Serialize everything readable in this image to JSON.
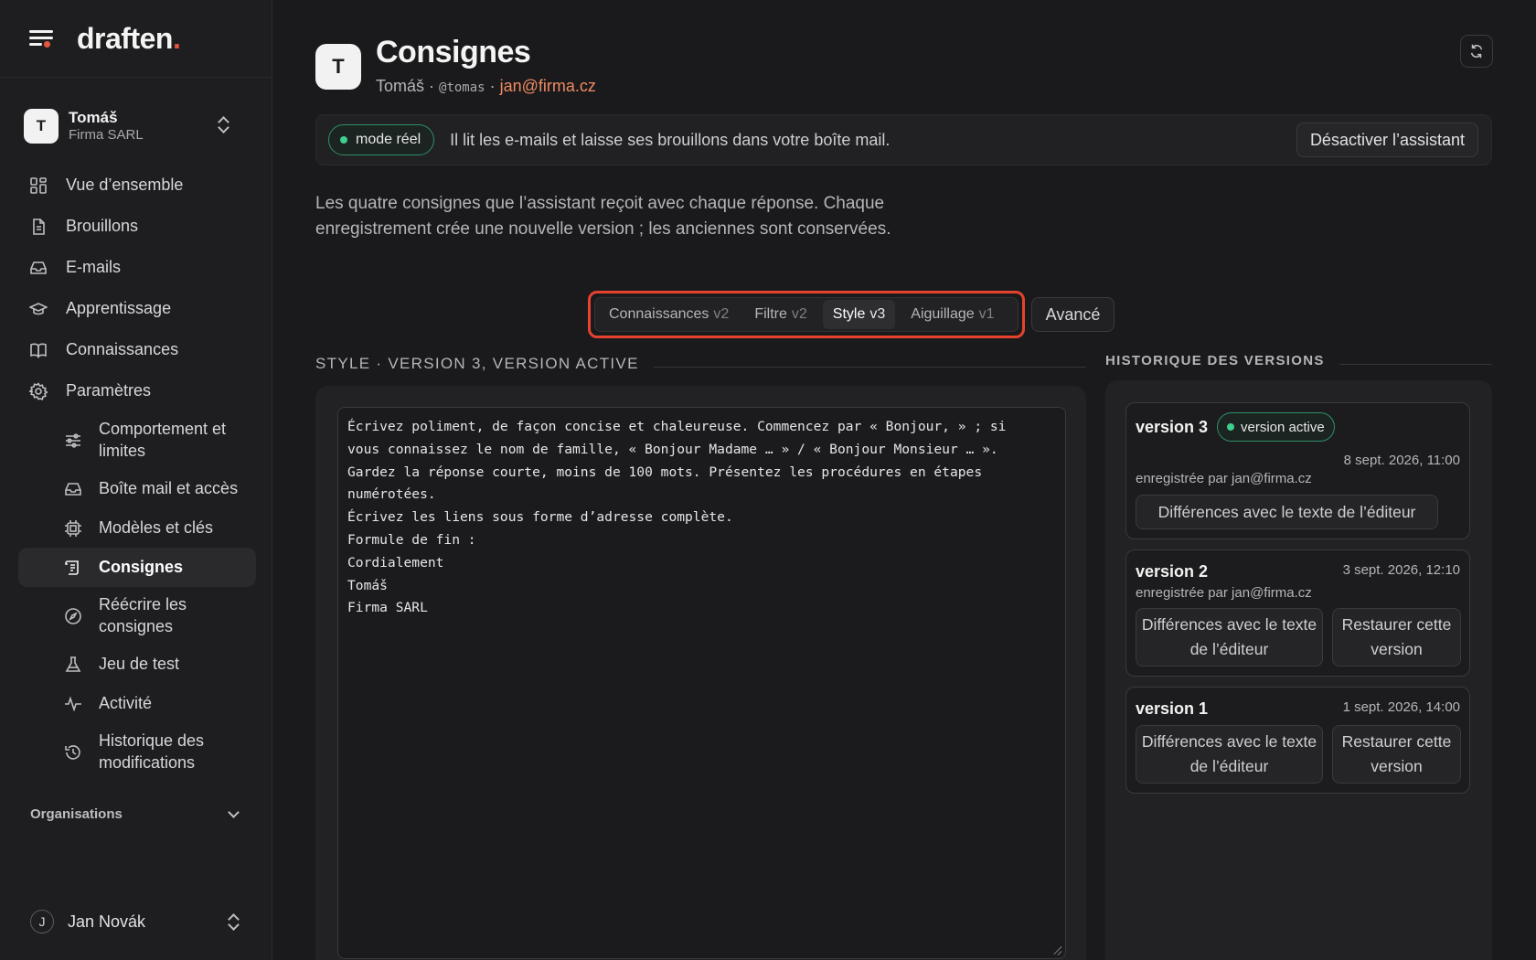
{
  "brand": {
    "name": "draften",
    "dot": "."
  },
  "account": {
    "initial": "T",
    "name": "Tomáš",
    "org": "Firma SARL"
  },
  "nav": {
    "items": [
      {
        "label": "Vue d’ensemble",
        "icon": "grid-icon"
      },
      {
        "label": "Brouillons",
        "icon": "document-icon"
      },
      {
        "label": "E-mails",
        "icon": "inbox-icon"
      },
      {
        "label": "Apprentissage",
        "icon": "graduation-cap-icon"
      },
      {
        "label": "Connaissances",
        "icon": "book-icon"
      },
      {
        "label": "Paramètres",
        "icon": "gear-icon"
      }
    ],
    "sub_items": [
      {
        "label": "Comportement et limites",
        "icon": "sliders-icon"
      },
      {
        "label": "Boîte mail et accès",
        "icon": "inbox-icon"
      },
      {
        "label": "Modèles et clés",
        "icon": "chip-icon"
      },
      {
        "label": "Consignes",
        "icon": "scroll-icon",
        "active": true
      },
      {
        "label": "Réécrire les consignes",
        "icon": "compass-icon"
      },
      {
        "label": "Jeu de test",
        "icon": "flask-icon"
      },
      {
        "label": "Activité",
        "icon": "activity-icon"
      },
      {
        "label": "Historique des modifications",
        "icon": "history-icon"
      }
    ]
  },
  "organisations_label": "Organisations",
  "user": {
    "initial": "J",
    "name": "Jan Novák"
  },
  "page": {
    "initial": "T",
    "title": "Consignes",
    "subtitle_name": "Tomáš",
    "subtitle_sep": " · ",
    "subtitle_handle": "@tomas",
    "subtitle_email": "jan@firma.cz"
  },
  "banner": {
    "mode_label": "mode réel",
    "message": "Il lit les e-mails et laisse ses brouillons dans votre boîte mail.",
    "deactivate_label": "Désactiver l’assistant"
  },
  "intro_text": "Les quatre consignes que l’assistant reçoit avec chaque réponse. Chaque enregistrement crée une nouvelle version ; les anciennes sont conservées.",
  "tabs": [
    {
      "label": "Connaissances",
      "version": "v2"
    },
    {
      "label": "Filtre",
      "version": "v2"
    },
    {
      "label": "Style",
      "version": "v3",
      "active": true
    },
    {
      "label": "Aiguillage",
      "version": "v1"
    }
  ],
  "advanced_label": "Avancé",
  "section_title": "STYLE · VERSION 3, VERSION ACTIVE",
  "editor_text": "Écrivez poliment, de façon concise et chaleureuse. Commencez par « Bonjour, » ; si\nvous connaissez le nom de famille, « Bonjour Madame … » / « Bonjour Monsieur … ».\nGardez la réponse courte, moins de 100 mots. Présentez les procédures en étapes\nnumérotées.\nÉcrivez les liens sous forme d’adresse complète.\nFormule de fin :\nCordialement\nTomáš\nFirma SARL",
  "history": {
    "title": "HISTORIQUE DES VERSIONS",
    "active_badge": "version active",
    "diff_label": "Différences avec le texte de l’éditeur",
    "restore_label": "Restaurer cette version",
    "versions": [
      {
        "label": "version 3",
        "date": "8 sept. 2026, 11:00",
        "by": "enregistrée par jan@firma.cz"
      },
      {
        "label": "version 2",
        "date": "3 sept. 2026, 12:10",
        "by": "enregistrée par jan@firma.cz"
      },
      {
        "label": "version 1",
        "date": "1 sept. 2026, 14:00"
      }
    ]
  },
  "colors": {
    "accent": "#e8553d",
    "email": "#ef8a62",
    "active_green": "#3ecf8e",
    "highlight_border": "#e5432d"
  }
}
